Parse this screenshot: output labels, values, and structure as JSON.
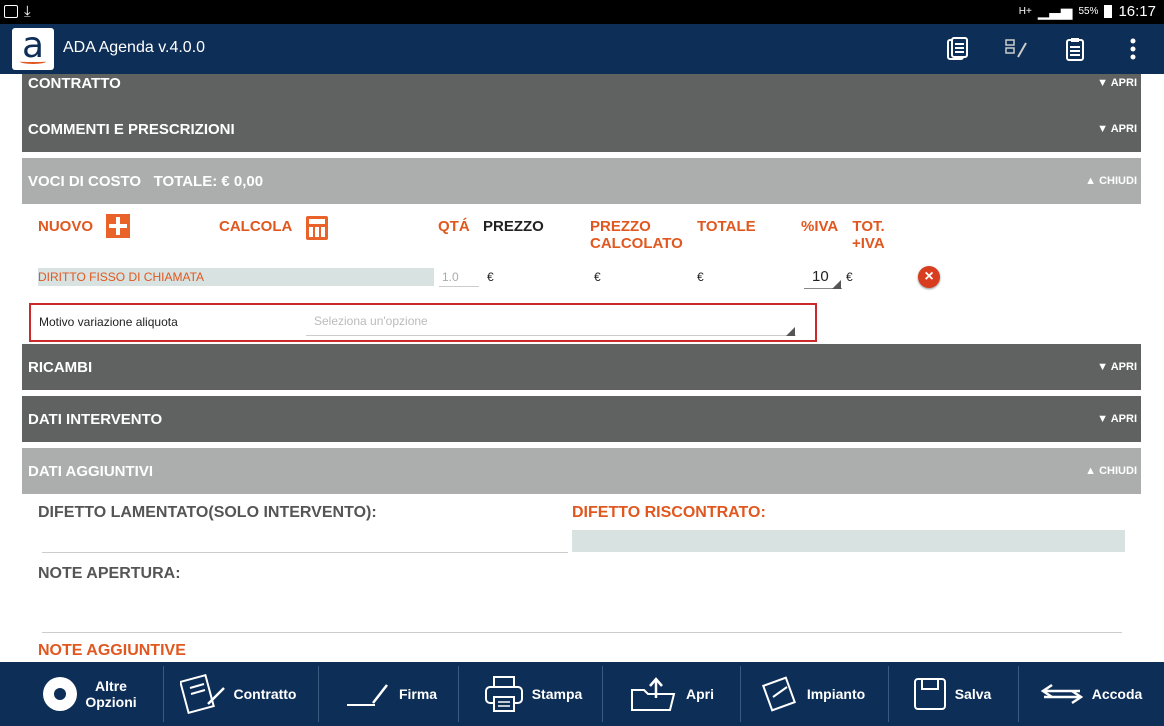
{
  "status_bar": {
    "signal": "H+",
    "battery": "55%",
    "time": "16:17"
  },
  "app": {
    "title": "ADA Agenda v.4.0.0",
    "logo": "a"
  },
  "appbar_icons": [
    "documents-icon",
    "edit-list-icon",
    "clipboard-icon",
    "more-vert-icon"
  ],
  "sections": {
    "contratto": {
      "title": "CONTRATTO",
      "toggle": "APRI"
    },
    "commenti": {
      "title": "COMMENTI E PRESCRIZIONI",
      "toggle": "APRI"
    },
    "voci": {
      "title": "VOCI DI COSTO",
      "total": "TOTALE: € 0,00",
      "toggle": "CHIUDI"
    },
    "ricambi": {
      "title": "RICAMBI",
      "toggle": "APRI"
    },
    "dati_intervento": {
      "title": "DATI INTERVENTO",
      "toggle": "APRI"
    },
    "dati_aggiuntivi": {
      "title": "DATI AGGIUNTIVI",
      "toggle": "CHIUDI"
    }
  },
  "costs_header": {
    "nuovo": "NUOVO",
    "calcola": "CALCOLA",
    "qta": "QTÁ",
    "prezzo": "PREZZO",
    "prezzo_calcolato_1": "PREZZO",
    "prezzo_calcolato_2": "CALCOLATO",
    "totale": "TOTALE",
    "iva": "%IVA",
    "tot_iva_1": "TOT.",
    "tot_iva_2": "+IVA"
  },
  "cost_row": {
    "description": "DIRITTO FISSO DI CHIAMATA",
    "qty": "1.0",
    "prezzo": "€",
    "prezzo_calcolato": "€",
    "totale": "€",
    "iva": "10",
    "tot_iva": "€"
  },
  "motivo": {
    "label": "Motivo variazione aliquota",
    "placeholder": "Seleziona un'opzione"
  },
  "dati_aggiuntivi": {
    "difetto_lamentato": "DIFETTO LAMENTATO(SOLO INTERVENTO):",
    "difetto_riscontrato": "DIFETTO RISCONTRATO:",
    "note_apertura": "NOTE APERTURA:",
    "note_aggiuntive": "NOTE AGGIUNTIVE"
  },
  "toolbar": {
    "altre_1": "Altre",
    "altre_2": "Opzioni",
    "contratto": "Contratto",
    "firma": "Firma",
    "stampa": "Stampa",
    "apri": "Apri",
    "impianto": "Impianto",
    "salva": "Salva",
    "accoda": "Accoda"
  },
  "colors": {
    "brand": "#0d2e57",
    "accent": "#e0581f",
    "section_dark": "#606262",
    "section_light": "#acadad"
  }
}
